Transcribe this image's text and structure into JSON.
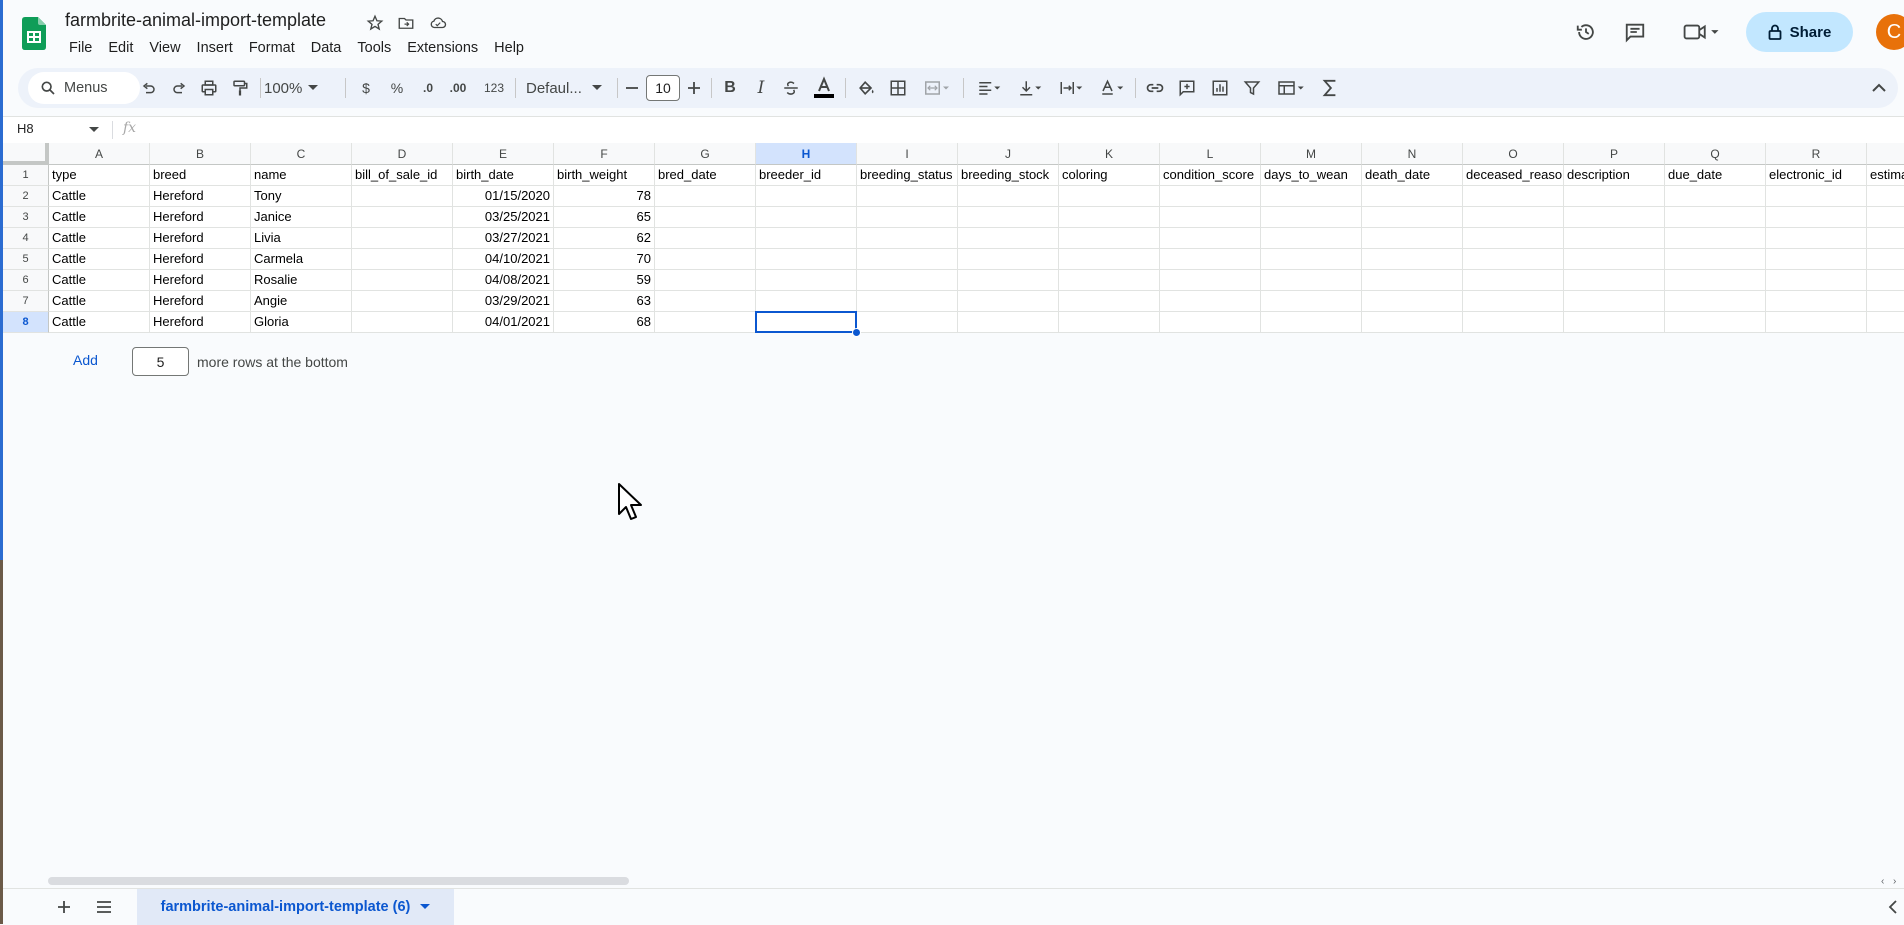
{
  "app": {
    "doc_title": "farmbrite-animal-import-template",
    "menus": [
      "File",
      "Edit",
      "View",
      "Insert",
      "Format",
      "Data",
      "Tools",
      "Extensions",
      "Help"
    ],
    "share_label": "Share",
    "avatar_initial": "C",
    "brand_color": "#0f9d58"
  },
  "toolbar": {
    "search_label": "Menus",
    "zoom": "100%",
    "currency": "$",
    "percent": "%",
    "decrease_decimal": ".0",
    "increase_decimal": ".00",
    "number_format": "123",
    "font": "Defaul...",
    "font_size": "10"
  },
  "formula_bar": {
    "cell_ref": "H8",
    "fx": "fx",
    "value": ""
  },
  "sheet": {
    "columns": [
      "A",
      "B",
      "C",
      "D",
      "E",
      "F",
      "G",
      "H",
      "I",
      "J",
      "K",
      "L",
      "M",
      "N",
      "O",
      "P",
      "Q",
      "R",
      ""
    ],
    "selected_column": "H",
    "rows": [
      [
        "type",
        "breed",
        "name",
        "bill_of_sale_id",
        "birth_date",
        "birth_weight",
        "bred_date",
        "breeder_id",
        "breeding_status",
        "breeding_stock",
        "coloring",
        "condition_score",
        "days_to_wean",
        "death_date",
        "deceased_reaso",
        "description",
        "due_date",
        "electronic_id",
        "estima"
      ],
      [
        "Cattle",
        "Hereford",
        "Tony",
        "",
        "01/15/2020",
        "78",
        "",
        "",
        "",
        "",
        "",
        "",
        "",
        "",
        "",
        "",
        "",
        "",
        ""
      ],
      [
        "Cattle",
        "Hereford",
        "Janice",
        "",
        "03/25/2021",
        "65",
        "",
        "",
        "",
        "",
        "",
        "",
        "",
        "",
        "",
        "",
        "",
        "",
        ""
      ],
      [
        "Cattle",
        "Hereford",
        "Livia",
        "",
        "03/27/2021",
        "62",
        "",
        "",
        "",
        "",
        "",
        "",
        "",
        "",
        "",
        "",
        "",
        "",
        ""
      ],
      [
        "Cattle",
        "Hereford",
        "Carmela",
        "",
        "04/10/2021",
        "70",
        "",
        "",
        "",
        "",
        "",
        "",
        "",
        "",
        "",
        "",
        "",
        "",
        ""
      ],
      [
        "Cattle",
        "Hereford",
        "Rosalie",
        "",
        "04/08/2021",
        "59",
        "",
        "",
        "",
        "",
        "",
        "",
        "",
        "",
        "",
        "",
        "",
        "",
        ""
      ],
      [
        "Cattle",
        "Hereford",
        "Angie",
        "",
        "03/29/2021",
        "63",
        "",
        "",
        "",
        "",
        "",
        "",
        "",
        "",
        "",
        "",
        "",
        "",
        ""
      ],
      [
        "Cattle",
        "Hereford",
        "Gloria",
        "",
        "04/01/2021",
        "68",
        "",
        "",
        "",
        "",
        "",
        "",
        "",
        "",
        "",
        "",
        "",
        "",
        ""
      ]
    ],
    "row_numbers": [
      "1",
      "2",
      "3",
      "4",
      "5",
      "6",
      "7",
      "8"
    ],
    "selected_row": "8",
    "active_cell": "H8"
  },
  "add_rows": {
    "button_label": "Add",
    "count": "5",
    "suffix": "more rows at the bottom"
  },
  "bottom": {
    "sheet_tab": "farmbrite-animal-import-template (6)"
  }
}
